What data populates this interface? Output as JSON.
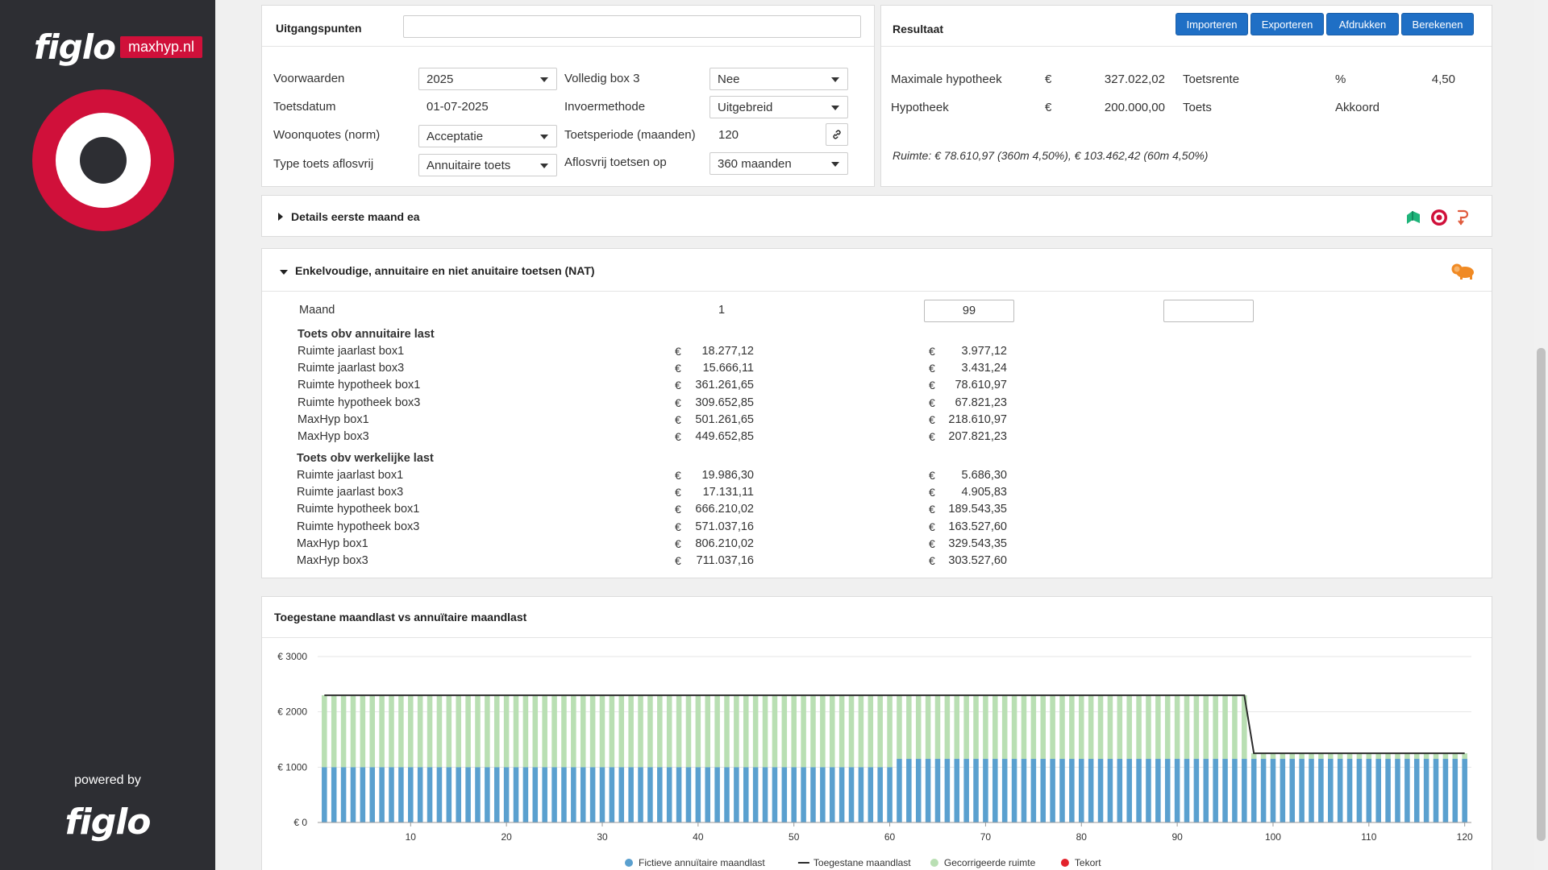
{
  "brand": {
    "logo_text": "figlo",
    "badge_text": "maxhyp.nl",
    "powered_by": "powered by",
    "bottom_logo": "figlo"
  },
  "uitgangspunten": {
    "title": "Uitgangspunten",
    "input_value": "",
    "fields": {
      "voorwaarden": {
        "label": "Voorwaarden",
        "value": "2025"
      },
      "toetsdatum": {
        "label": "Toetsdatum",
        "value": "01-07-2025"
      },
      "woonquotes": {
        "label": "Woonquotes (norm)",
        "value": "Acceptatie"
      },
      "type_toets": {
        "label": "Type toets aflosvrij",
        "value": "Annuitaire toets"
      },
      "volledig_box3": {
        "label": "Volledig box 3",
        "value": "Nee"
      },
      "invoermethode": {
        "label": "Invoermethode",
        "value": "Uitgebreid"
      },
      "toetsperiode": {
        "label": "Toetsperiode (maanden)",
        "value": "120"
      },
      "aflosvrij_op": {
        "label": "Aflosvrij toetsen op",
        "value": "360 maanden"
      }
    }
  },
  "resultaat": {
    "title": "Resultaat",
    "buttons": {
      "importeren": "Importeren",
      "exporteren": "Exporteren",
      "afdrukken": "Afdrukken",
      "berekenen": "Berekenen"
    },
    "max_hyp_label": "Maximale hypotheek",
    "max_hyp_cur": "€",
    "max_hyp_value": "327.022,02",
    "toetsrente_label": "Toetsrente",
    "toetsrente_unit": "%",
    "toetsrente_value": "4,50",
    "hyp_label": "Hypotheek",
    "hyp_cur": "€",
    "hyp_value": "200.000,00",
    "toets_label": "Toets",
    "toets_value": "Akkoord",
    "ruimte_note": "Ruimte: € 78.610,97 (360m 4,50%), € 103.462,42 (60m 4,50%)"
  },
  "details": {
    "title": "Details eerste maand ea"
  },
  "nat": {
    "title": "Enkelvoudige, annuitaire en niet anuitaire toetsen (NAT)",
    "maand_label": "Maand",
    "maand_col1": "1",
    "maand_col2": "99",
    "maand_col3": "",
    "currency": "€",
    "section1_title": "Toets obv annuitaire last",
    "section1_rows": [
      {
        "label": "Ruimte jaarlast box1",
        "v1": "18.277,12",
        "v2": "3.977,12"
      },
      {
        "label": "Ruimte jaarlast box3",
        "v1": "15.666,11",
        "v2": "3.431,24"
      },
      {
        "label": "Ruimte hypotheek box1",
        "v1": "361.261,65",
        "v2": "78.610,97"
      },
      {
        "label": "Ruimte hypotheek box3",
        "v1": "309.652,85",
        "v2": "67.821,23"
      },
      {
        "label": "MaxHyp box1",
        "v1": "501.261,65",
        "v2": "218.610,97"
      },
      {
        "label": "MaxHyp box3",
        "v1": "449.652,85",
        "v2": "207.821,23"
      }
    ],
    "section2_title": "Toets obv werkelijke last",
    "section2_rows": [
      {
        "label": "Ruimte jaarlast box1",
        "v1": "19.986,30",
        "v2": "5.686,30"
      },
      {
        "label": "Ruimte jaarlast box3",
        "v1": "17.131,11",
        "v2": "4.905,83"
      },
      {
        "label": "Ruimte hypotheek box1",
        "v1": "666.210,02",
        "v2": "189.543,35"
      },
      {
        "label": "Ruimte hypotheek box3",
        "v1": "571.037,16",
        "v2": "163.527,60"
      },
      {
        "label": "MaxHyp box1",
        "v1": "806.210,02",
        "v2": "329.543,35"
      },
      {
        "label": "MaxHyp box3",
        "v1": "711.037,16",
        "v2": "303.527,60"
      }
    ]
  },
  "chart_panel": {
    "title": "Toegestane maandlast vs annuïtaire maandlast"
  },
  "chart_data": {
    "type": "bar",
    "title": "Toegestane maandlast vs annuïtaire maandlast",
    "xlabel": "",
    "ylabel": "",
    "xlim": [
      1,
      120
    ],
    "xticks": [
      10,
      20,
      30,
      40,
      50,
      60,
      70,
      80,
      90,
      100,
      110,
      120
    ],
    "ylim": [
      0,
      3000
    ],
    "yticks": [
      0,
      1000,
      2000,
      3000
    ],
    "ytick_labels": [
      "€ 0",
      "€ 1000",
      "€ 2000",
      "€ 3000"
    ],
    "grid": true,
    "legend_position": "bottom",
    "series": [
      {
        "name": "Fictieve annuïtaire maandlast",
        "kind": "stacked-bar",
        "color": "#5aa0cf",
        "segments": [
          {
            "from": 1,
            "to": 60,
            "value": 1000
          },
          {
            "from": 61,
            "to": 120,
            "value": 1150
          }
        ]
      },
      {
        "name": "Toegestane maandlast",
        "kind": "line",
        "color": "#2b2b2b",
        "points": [
          [
            1,
            2300
          ],
          [
            97,
            2300
          ],
          [
            98,
            1250
          ],
          [
            120,
            1250
          ]
        ]
      },
      {
        "name": "Gecorrigeerde ruimte",
        "kind": "stacked-bar",
        "color": "#b9dfb3",
        "segments": [
          {
            "from": 1,
            "to": 60,
            "value": 1300
          },
          {
            "from": 61,
            "to": 97,
            "value": 1150
          },
          {
            "from": 98,
            "to": 120,
            "value": 100
          }
        ]
      },
      {
        "name": "Tekort",
        "kind": "stacked-bar",
        "color": "#e3232d",
        "segments": []
      }
    ]
  }
}
